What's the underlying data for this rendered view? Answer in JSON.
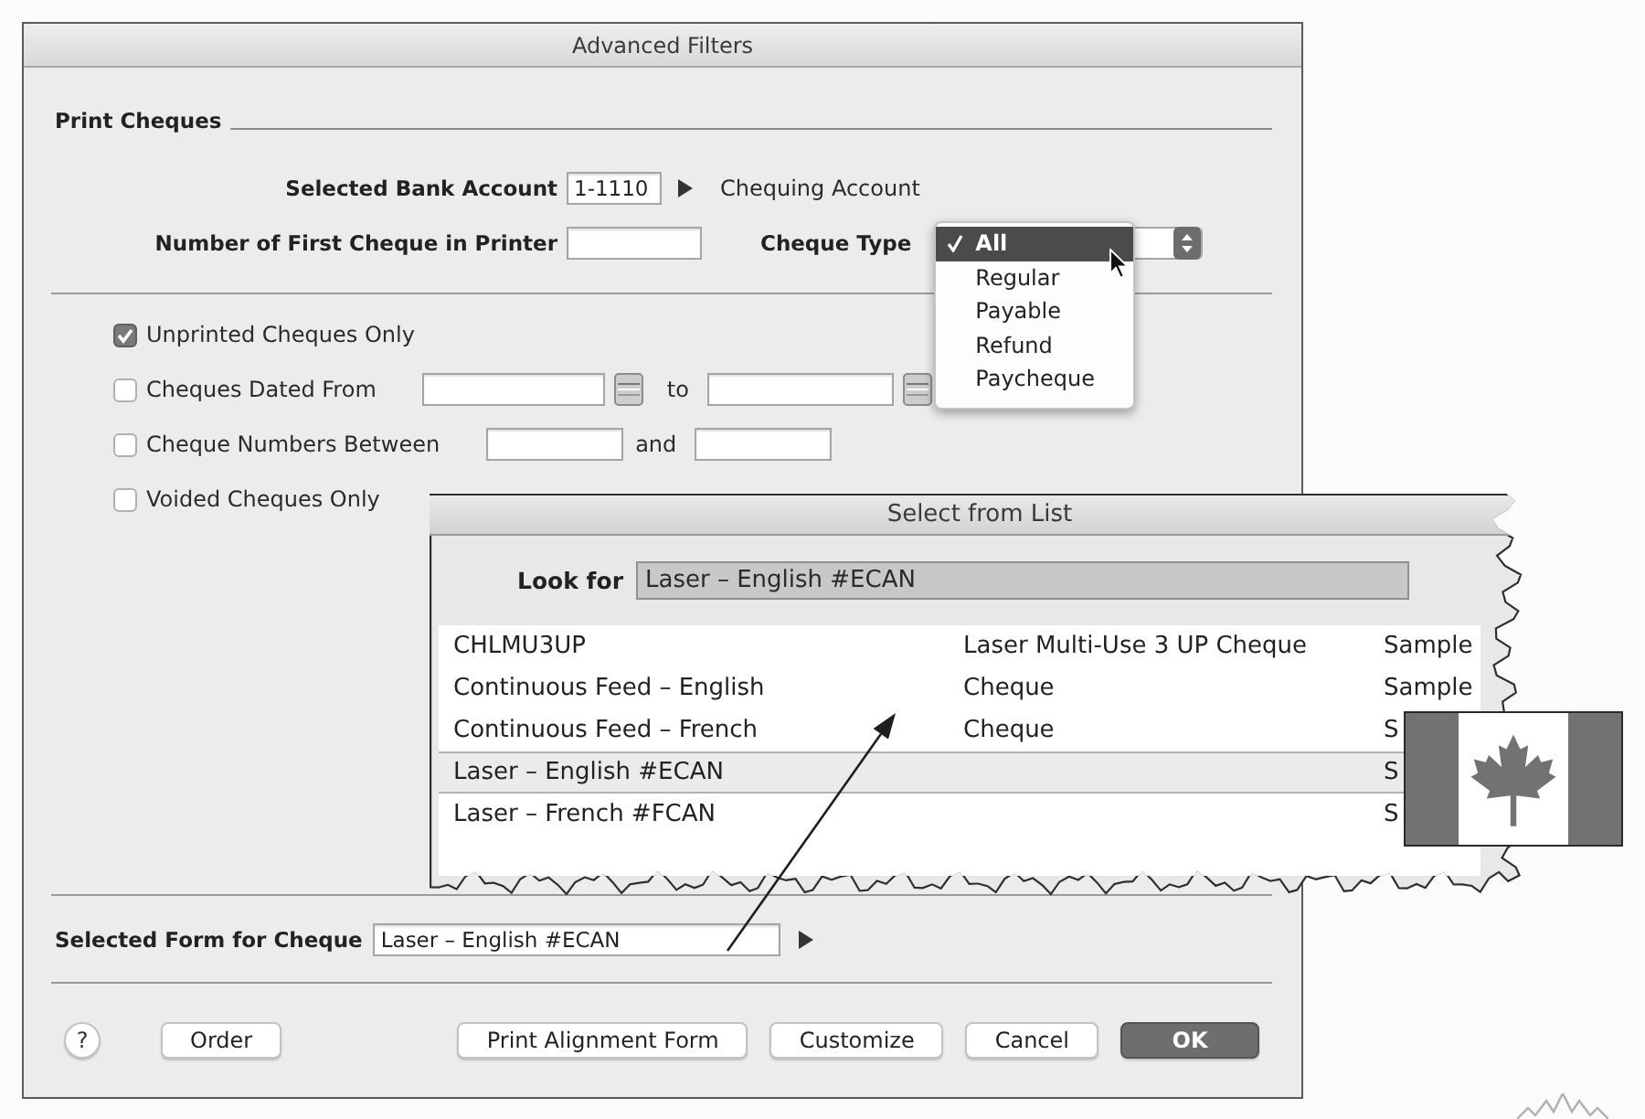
{
  "window": {
    "title": "Advanced Filters"
  },
  "print_cheques": {
    "heading": "Print Cheques",
    "bank_account": {
      "label": "Selected Bank Account",
      "value": "1-1110",
      "account_name": "Chequing Account"
    },
    "first_cheque": {
      "label": "Number of First Cheque in Printer"
    },
    "cheque_type": {
      "label": "Cheque Type",
      "expanded": true,
      "options": [
        {
          "label": "All",
          "selected": true
        },
        {
          "label": "Regular",
          "selected": false
        },
        {
          "label": "Payable",
          "selected": false
        },
        {
          "label": "Refund",
          "selected": false
        },
        {
          "label": "Paycheque",
          "selected": false
        }
      ]
    }
  },
  "filters": [
    {
      "kind": "check",
      "label": "Unprinted Cheques Only",
      "checked": true
    },
    {
      "kind": "date_range",
      "label": "Cheques Dated From",
      "checked": false,
      "joiner": "to"
    },
    {
      "kind": "number_range",
      "label": "Cheque Numbers Between",
      "checked": false,
      "joiner": "and"
    },
    {
      "kind": "check",
      "label": "Voided Cheques Only",
      "checked": false
    }
  ],
  "select_from_list": {
    "title": "Select from List",
    "look_for": {
      "label": "Look for",
      "value": "Laser – English #ECAN"
    },
    "rows": [
      {
        "column_1": "CHLMU3UP",
        "column_2": "Laser Multi-Use 3 UP Cheque",
        "column_3": "Sample",
        "selected": false
      },
      {
        "column_1": "Continuous Feed – English",
        "column_2": "Cheque",
        "column_3": "Sample",
        "selected": false
      },
      {
        "column_1": "Continuous Feed – French",
        "column_2": "Cheque",
        "column_3": "S",
        "selected": false
      },
      {
        "column_1": "Laser – English #ECAN",
        "column_3": "S",
        "selected": true
      },
      {
        "column_1": "Laser – French #FCAN",
        "column_3": "S",
        "selected": false
      }
    ]
  },
  "selected_form": {
    "label": "Selected Form for Cheque",
    "value": "Laser – English #ECAN"
  },
  "buttons": {
    "left": [
      {
        "label": "?",
        "kind": "help"
      },
      {
        "label": "Order",
        "kind": "push"
      }
    ],
    "right": [
      {
        "label": "Print Alignment Form",
        "kind": "push"
      },
      {
        "label": "Customize",
        "kind": "push"
      },
      {
        "label": "Cancel",
        "kind": "push"
      },
      {
        "label": "OK",
        "kind": "default"
      }
    ]
  }
}
